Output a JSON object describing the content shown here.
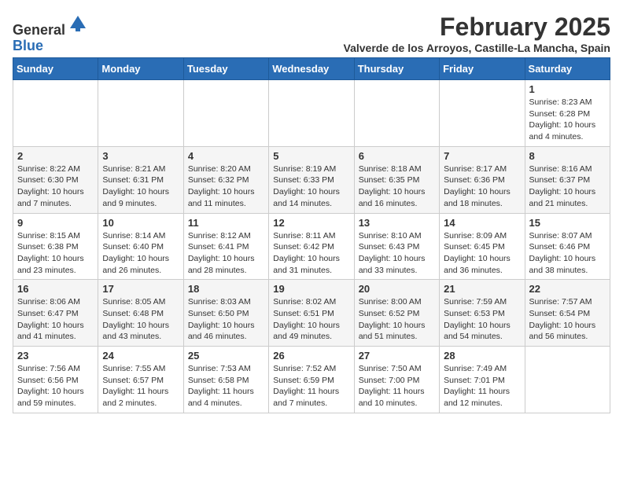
{
  "logo": {
    "general": "General",
    "blue": "Blue"
  },
  "title": "February 2025",
  "subtitle": "Valverde de los Arroyos, Castille-La Mancha, Spain",
  "days_header": [
    "Sunday",
    "Monday",
    "Tuesday",
    "Wednesday",
    "Thursday",
    "Friday",
    "Saturday"
  ],
  "weeks": [
    [
      {
        "day": "",
        "info": ""
      },
      {
        "day": "",
        "info": ""
      },
      {
        "day": "",
        "info": ""
      },
      {
        "day": "",
        "info": ""
      },
      {
        "day": "",
        "info": ""
      },
      {
        "day": "",
        "info": ""
      },
      {
        "day": "1",
        "info": "Sunrise: 8:23 AM\nSunset: 6:28 PM\nDaylight: 10 hours and 4 minutes."
      }
    ],
    [
      {
        "day": "2",
        "info": "Sunrise: 8:22 AM\nSunset: 6:30 PM\nDaylight: 10 hours and 7 minutes."
      },
      {
        "day": "3",
        "info": "Sunrise: 8:21 AM\nSunset: 6:31 PM\nDaylight: 10 hours and 9 minutes."
      },
      {
        "day": "4",
        "info": "Sunrise: 8:20 AM\nSunset: 6:32 PM\nDaylight: 10 hours and 11 minutes."
      },
      {
        "day": "5",
        "info": "Sunrise: 8:19 AM\nSunset: 6:33 PM\nDaylight: 10 hours and 14 minutes."
      },
      {
        "day": "6",
        "info": "Sunrise: 8:18 AM\nSunset: 6:35 PM\nDaylight: 10 hours and 16 minutes."
      },
      {
        "day": "7",
        "info": "Sunrise: 8:17 AM\nSunset: 6:36 PM\nDaylight: 10 hours and 18 minutes."
      },
      {
        "day": "8",
        "info": "Sunrise: 8:16 AM\nSunset: 6:37 PM\nDaylight: 10 hours and 21 minutes."
      }
    ],
    [
      {
        "day": "9",
        "info": "Sunrise: 8:15 AM\nSunset: 6:38 PM\nDaylight: 10 hours and 23 minutes."
      },
      {
        "day": "10",
        "info": "Sunrise: 8:14 AM\nSunset: 6:40 PM\nDaylight: 10 hours and 26 minutes."
      },
      {
        "day": "11",
        "info": "Sunrise: 8:12 AM\nSunset: 6:41 PM\nDaylight: 10 hours and 28 minutes."
      },
      {
        "day": "12",
        "info": "Sunrise: 8:11 AM\nSunset: 6:42 PM\nDaylight: 10 hours and 31 minutes."
      },
      {
        "day": "13",
        "info": "Sunrise: 8:10 AM\nSunset: 6:43 PM\nDaylight: 10 hours and 33 minutes."
      },
      {
        "day": "14",
        "info": "Sunrise: 8:09 AM\nSunset: 6:45 PM\nDaylight: 10 hours and 36 minutes."
      },
      {
        "day": "15",
        "info": "Sunrise: 8:07 AM\nSunset: 6:46 PM\nDaylight: 10 hours and 38 minutes."
      }
    ],
    [
      {
        "day": "16",
        "info": "Sunrise: 8:06 AM\nSunset: 6:47 PM\nDaylight: 10 hours and 41 minutes."
      },
      {
        "day": "17",
        "info": "Sunrise: 8:05 AM\nSunset: 6:48 PM\nDaylight: 10 hours and 43 minutes."
      },
      {
        "day": "18",
        "info": "Sunrise: 8:03 AM\nSunset: 6:50 PM\nDaylight: 10 hours and 46 minutes."
      },
      {
        "day": "19",
        "info": "Sunrise: 8:02 AM\nSunset: 6:51 PM\nDaylight: 10 hours and 49 minutes."
      },
      {
        "day": "20",
        "info": "Sunrise: 8:00 AM\nSunset: 6:52 PM\nDaylight: 10 hours and 51 minutes."
      },
      {
        "day": "21",
        "info": "Sunrise: 7:59 AM\nSunset: 6:53 PM\nDaylight: 10 hours and 54 minutes."
      },
      {
        "day": "22",
        "info": "Sunrise: 7:57 AM\nSunset: 6:54 PM\nDaylight: 10 hours and 56 minutes."
      }
    ],
    [
      {
        "day": "23",
        "info": "Sunrise: 7:56 AM\nSunset: 6:56 PM\nDaylight: 10 hours and 59 minutes."
      },
      {
        "day": "24",
        "info": "Sunrise: 7:55 AM\nSunset: 6:57 PM\nDaylight: 11 hours and 2 minutes."
      },
      {
        "day": "25",
        "info": "Sunrise: 7:53 AM\nSunset: 6:58 PM\nDaylight: 11 hours and 4 minutes."
      },
      {
        "day": "26",
        "info": "Sunrise: 7:52 AM\nSunset: 6:59 PM\nDaylight: 11 hours and 7 minutes."
      },
      {
        "day": "27",
        "info": "Sunrise: 7:50 AM\nSunset: 7:00 PM\nDaylight: 11 hours and 10 minutes."
      },
      {
        "day": "28",
        "info": "Sunrise: 7:49 AM\nSunset: 7:01 PM\nDaylight: 11 hours and 12 minutes."
      },
      {
        "day": "",
        "info": ""
      }
    ]
  ]
}
